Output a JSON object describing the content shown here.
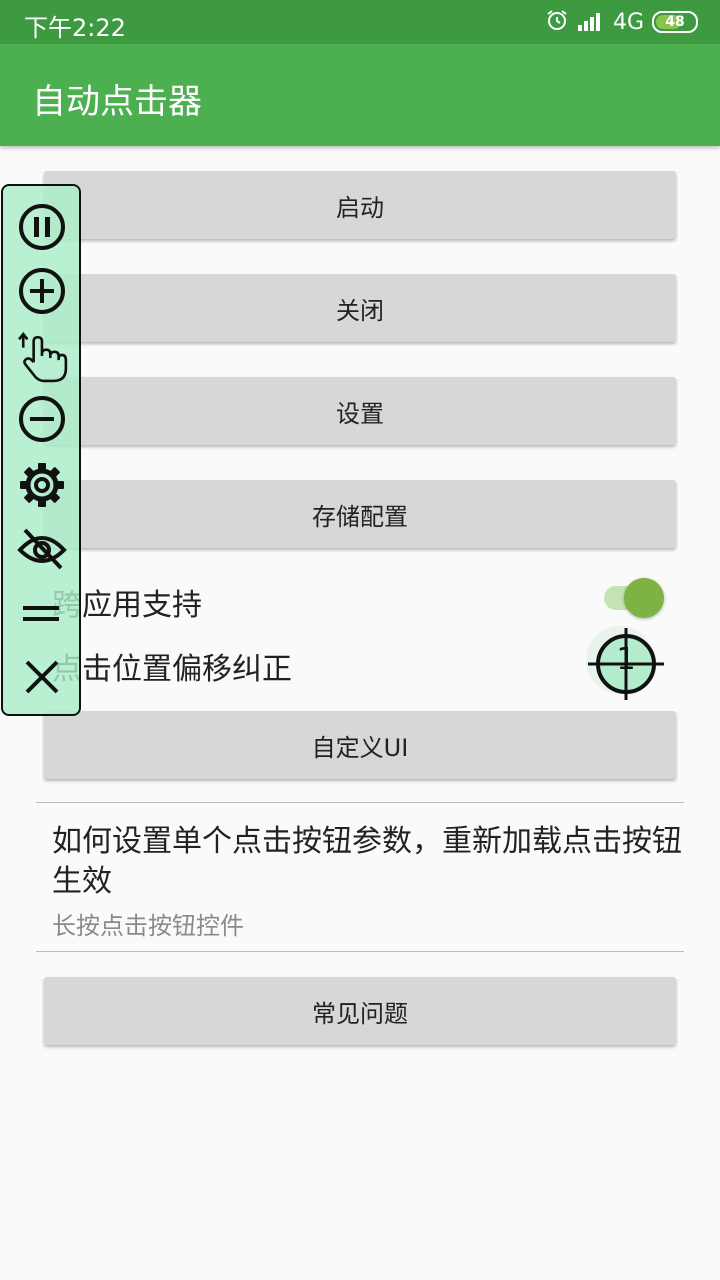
{
  "status_bar": {
    "time": "下午2:22",
    "network": "4G",
    "battery": "48",
    "icons": [
      "alarm-icon",
      "signal-icon",
      "battery-icon"
    ]
  },
  "app_bar": {
    "title": "自动点击器"
  },
  "buttons": {
    "start": "启动",
    "close": "关闭",
    "settings": "设置",
    "save_config": "存储配置",
    "custom_ui": "自定义UI",
    "faq": "常见问题"
  },
  "settings_rows": {
    "cross_app": {
      "label": "跨应用支持",
      "enabled": true
    },
    "offset_correction": {
      "label": "点击位置偏移纠正",
      "marker_number": "1"
    }
  },
  "help": {
    "title": "如何设置单个点击按钮参数，重新加载点击按钮生效",
    "subtitle": "长按点击按钮控件"
  },
  "floating_toolbar": {
    "icons": [
      "pause-icon",
      "add-icon",
      "tap-gesture-icon",
      "remove-icon",
      "gear-icon",
      "hide-eye-icon",
      "drag-handle-icon",
      "close-icon"
    ]
  },
  "colors": {
    "status_bar": "#3e9a41",
    "app_bar": "#4caf50",
    "button": "#d6d7d7",
    "toggle_thumb": "#7cb342",
    "panel": "#aaeec8"
  }
}
